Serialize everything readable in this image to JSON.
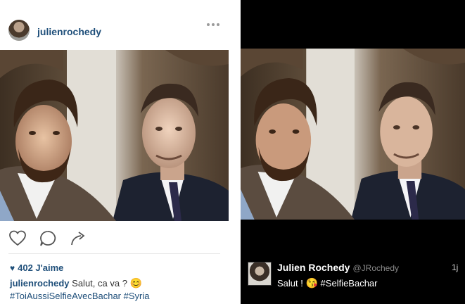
{
  "instagram": {
    "username": "julienrochedy",
    "more_icon": "more-dots-icon",
    "actions": {
      "like_icon": "heart-outline-icon",
      "comment_icon": "comment-bubble-icon",
      "share_icon": "share-arrow-icon"
    },
    "likes_text": "402 J'aime",
    "caption_user": "julienrochedy",
    "caption_text": "Salut, ca va ?",
    "caption_emoji": "😊",
    "hashtags": "#ToiAussiSelfieAvecBachar #Syria",
    "accent_color": "#1f4f7a"
  },
  "tweet": {
    "name": "Julien Rochedy",
    "handle": "@JRochedy",
    "time": "1j",
    "text_start": "Salut !",
    "emoji": "😘",
    "hashtag": "#SelfieBachar",
    "background_color": "#000000"
  }
}
